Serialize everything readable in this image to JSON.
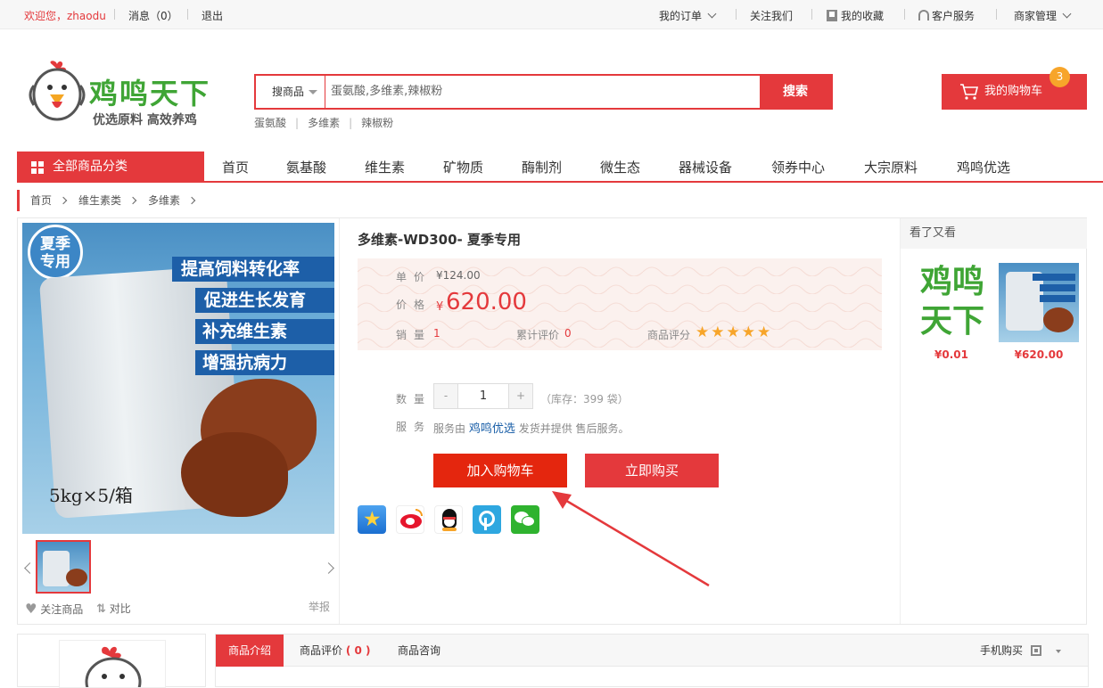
{
  "topbar": {
    "welcome": "欢迎您，zhaodu",
    "messages": "消息（0）",
    "logout": "退出",
    "my_orders": "我的订单",
    "follow_us": "关注我们",
    "favorites": "我的收藏",
    "customer_service": "客户服务",
    "merchant": "商家管理"
  },
  "logo": {
    "name": "鸡鸣天下",
    "slogan": "优选原料 高效养鸡"
  },
  "search": {
    "category": "搜商品",
    "placeholder": "蛋氨酸,多维素,辣椒粉",
    "button": "搜索",
    "hotwords": [
      "蛋氨酸",
      "多维素",
      "辣椒粉"
    ]
  },
  "cart": {
    "label": "我的购物车",
    "count": "3"
  },
  "nav": {
    "all": "全部商品分类",
    "items": [
      "首页",
      "氨基酸",
      "维生素",
      "矿物质",
      "酶制剂",
      "微生态",
      "器械设备",
      "领券中心",
      "大宗原料",
      "鸡鸣优选"
    ]
  },
  "breadcrumb": [
    "首页",
    "维生素类",
    "多维素"
  ],
  "product": {
    "title": "多维素-WD300- 夏季专用",
    "unit_label": "单价",
    "unit_price": "¥124.00",
    "price_label": "价格",
    "currency": "¥",
    "price": "620.00",
    "sales_label": "销量",
    "sales": "1",
    "reviews_label": "累计评价",
    "reviews": "0",
    "rating_label": "商品评分",
    "rating": 5,
    "qty_label": "数量",
    "qty": "1",
    "minus": "-",
    "plus": "+",
    "stock": "（库存：399 袋）",
    "service_label": "服务",
    "service_pre": "服务由",
    "service_shop": "鸡鸣优选",
    "service_post": "发货并提供 售后服务。",
    "add_cart": "加入购物车",
    "buy_now": "立即购买",
    "image_text": {
      "badge_top": "夏季",
      "badge_bottom": "专用",
      "line1": "提高饲料转化率",
      "line2": "促进生长发育",
      "line3": "补充维生素",
      "line4": "增强抗病力",
      "pack": "5kg×5/箱"
    },
    "follow": "关注商品",
    "compare": "对比",
    "report": "举报"
  },
  "see_also": {
    "title": "看了又看",
    "items": [
      {
        "price": "¥0.01"
      },
      {
        "price": "¥620.00"
      }
    ]
  },
  "tabs": {
    "intro": "商品介绍",
    "review": "商品评价",
    "review_count": "( 0 )",
    "consult": "商品咨询",
    "mobile": "手机购买"
  },
  "colors": {
    "accent": "#e4393c",
    "star": "#f7a52a"
  }
}
